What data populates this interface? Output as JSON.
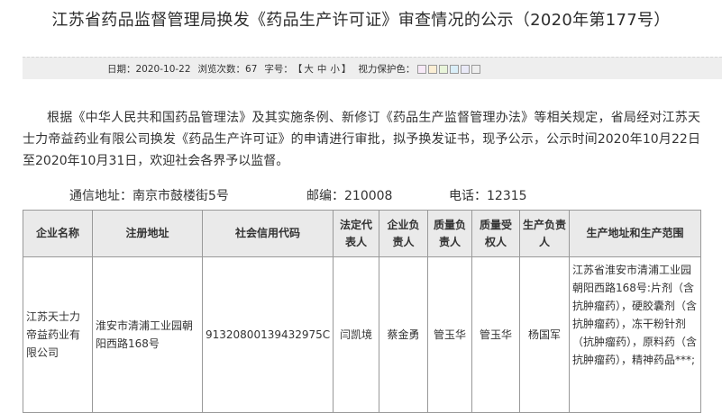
{
  "page": {
    "title": "江苏省药品监督管理局换发《药品生产许可证》审查情况的公示（2020年第177号）"
  },
  "infobar": {
    "date_label": "日期：",
    "date_value": "2020-10-22",
    "views_label": "浏览次数：",
    "views_value": "67",
    "fontsize_label": "字号：",
    "fontsize_open": "【",
    "fontsize_large": "大",
    "fontsize_medium": "中",
    "fontsize_small": "小",
    "fontsize_close": "】",
    "eyecare_label": "视力保护色：",
    "eyecare_colors": [
      "#f7e9f7",
      "#fbeed4",
      "#e8f4d9",
      "#d9eef8",
      "#e9e9f7",
      "#eeeeee"
    ]
  },
  "body": {
    "paragraph": "根据《中华人民共和国药品管理法》及其实施条例、新修订《药品生产监督管理办法》等相关规定，省局经对江苏天士力帝益药业有限公司换发《药品生产许可证》的申请进行审批，拟予换发证书，现予公示，公示时间2020年10月22日至2020年10月31日，欢迎社会各界予以监督。"
  },
  "contact": {
    "address": "通信地址：南京市鼓楼街5号",
    "postcode": "邮编：210008",
    "phone": "电话：12315"
  },
  "table": {
    "headers": {
      "company": "企业名称",
      "reg_address": "注册地址",
      "credit_code": "社会信用代码",
      "legal_rep": "法定代表人",
      "company_head": "企业负责人",
      "quality_head": "质量负责人",
      "quality_auth": "质量受权人",
      "production_head": "生产负责人",
      "scope": "生产地址和生产范围"
    },
    "row": {
      "company": "江苏天士力帝益药业有限公司",
      "reg_address": "淮安市清浦工业园朝阳西路168号",
      "credit_code": "91320800139432975C",
      "legal_rep": "闫凯境",
      "company_head": "蔡金勇",
      "quality_head": "管玉华",
      "quality_auth": "管玉华",
      "production_head": "杨国军",
      "scope": "江苏省淮安市清浦工业园朝阳西路168号:片剂（含抗肿瘤药），硬胶囊剂（含抗肿瘤药），冻干粉针剂（抗肿瘤药），原料药（含抗肿瘤药），精神药品***;"
    }
  }
}
